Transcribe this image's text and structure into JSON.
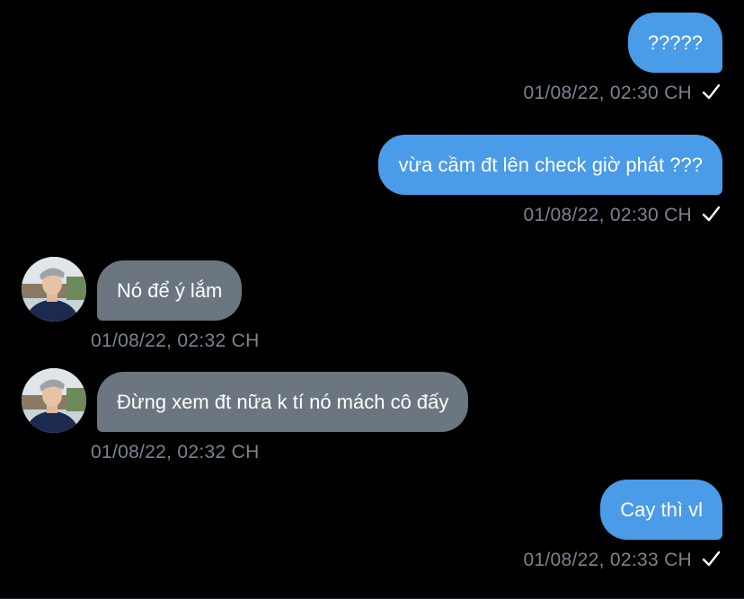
{
  "messages": [
    {
      "direction": "outgoing",
      "text": "?????",
      "time": "01/08/22, 02:30 CH",
      "read": true
    },
    {
      "direction": "outgoing",
      "text": "vừa cầm đt lên check giờ phát ???",
      "time": "01/08/22, 02:30 CH",
      "read": true
    },
    {
      "direction": "incoming",
      "text": "Nó để ý lắm",
      "time": "01/08/22, 02:32 CH"
    },
    {
      "direction": "incoming",
      "text": "Đừng xem đt nữa k tí nó mách cô đấy",
      "time": "01/08/22, 02:32 CH"
    },
    {
      "direction": "outgoing",
      "text": "Cay thì vl",
      "time": "01/08/22, 02:33 CH",
      "read": true
    }
  ],
  "colors": {
    "background": "#000000",
    "outgoing_bubble": "#4a9be8",
    "incoming_bubble": "#6c7680",
    "timestamp": "#7a8490"
  },
  "icons": {
    "read_receipt": "checkmark-icon",
    "avatar": "contact-avatar-photo"
  }
}
